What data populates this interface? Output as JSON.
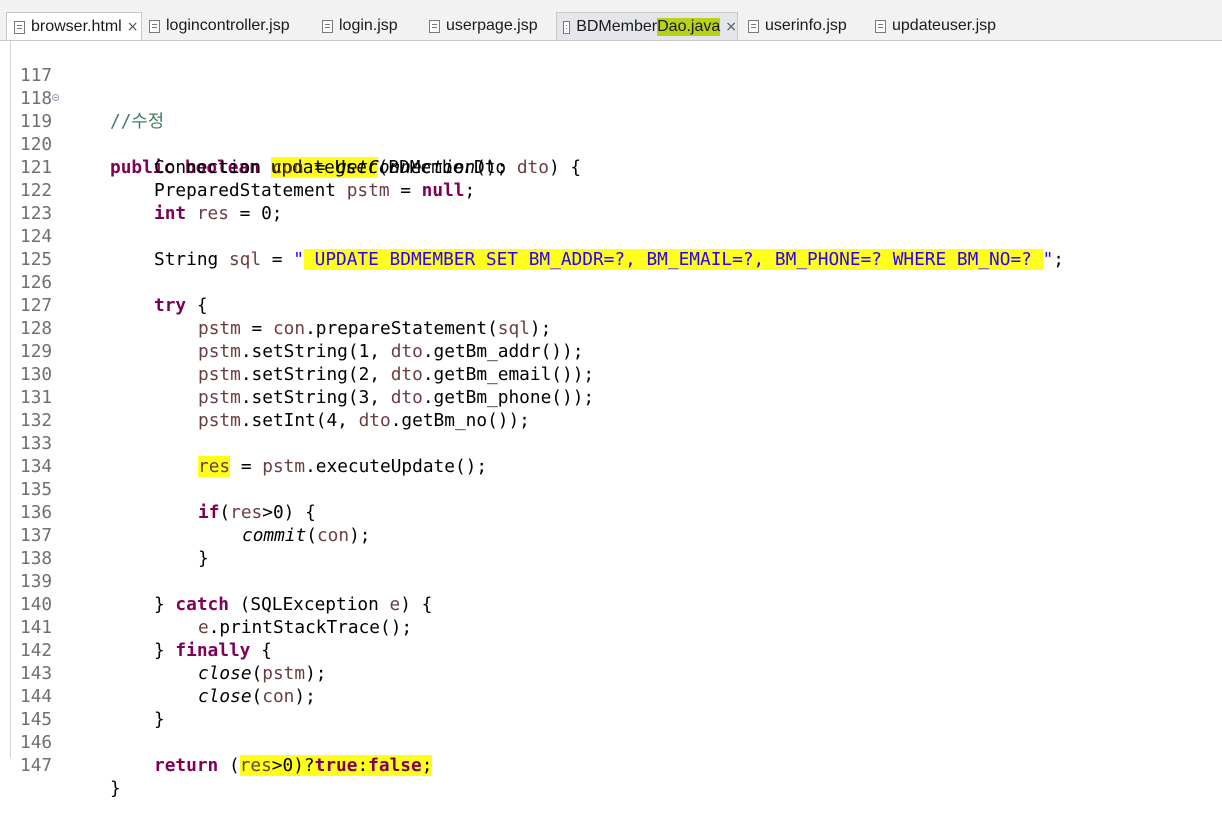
{
  "tabs": [
    {
      "label": "browser.html",
      "icon": "html-file-icon",
      "active": true,
      "closable": true
    },
    {
      "label": "logincontroller.jsp",
      "icon": "jsp-file-icon"
    },
    {
      "label": "login.jsp",
      "icon": "jsp-file-icon"
    },
    {
      "label": "userpage.jsp",
      "icon": "jsp-file-icon"
    },
    {
      "label_prefix": "BDMember",
      "label_highlight": "Dao.java",
      "icon": "java-file-icon",
      "selected": true,
      "closable": true
    },
    {
      "label": "userinfo.jsp",
      "icon": "jsp-file-icon"
    },
    {
      "label": "updateuser.jsp",
      "icon": "jsp-file-icon"
    }
  ],
  "close_glyph": "×",
  "highlight_color": "#ffff1a",
  "line_numbers": [
    "117",
    "118",
    "119",
    "120",
    "121",
    "122",
    "123",
    "124",
    "125",
    "126",
    "127",
    "128",
    "129",
    "130",
    "131",
    "132",
    "133",
    "134",
    "135",
    "136",
    "137",
    "138",
    "139",
    "140",
    "141",
    "142",
    "143",
    "144",
    "145",
    "146",
    "147"
  ],
  "code": {
    "l118": "//수정",
    "l119": [
      "public",
      " ",
      "boolean",
      " ",
      "updateUser",
      "(BDMemberDto ",
      "dto",
      ") {"
    ],
    "l120": [
      "Connection ",
      "con",
      " = ",
      "getConnection",
      "();"
    ],
    "l121": [
      "PreparedStatement ",
      "pstm",
      " = ",
      "null",
      ";"
    ],
    "l122": [
      "int",
      " ",
      "res",
      " = 0;"
    ],
    "l124": [
      "String ",
      "sql",
      " = ",
      "\"",
      " UPDATE BDMEMBER SET BM_ADDR=?, BM_EMAIL=?, BM_PHONE=? WHERE BM_NO=? ",
      "\"",
      ";"
    ],
    "l126": [
      "try",
      " {"
    ],
    "l127": [
      "pstm",
      " = ",
      "con",
      ".prepareStatement(",
      "sql",
      ");"
    ],
    "l128": [
      "pstm",
      ".setString(1, ",
      "dto",
      ".getBm_addr());"
    ],
    "l129": [
      "pstm",
      ".setString(2, ",
      "dto",
      ".getBm_email());"
    ],
    "l130": [
      "pstm",
      ".setString(3, ",
      "dto",
      ".getBm_phone());"
    ],
    "l131": [
      "pstm",
      ".setInt(4, ",
      "dto",
      ".getBm_no());"
    ],
    "l133": [
      "res",
      " = ",
      "pstm",
      ".executeUpdate();"
    ],
    "l135": [
      "if",
      "(",
      "res",
      ">0) {"
    ],
    "l136": [
      "commit",
      "(",
      "con",
      ");"
    ],
    "l137": "}",
    "l139": [
      "} ",
      "catch",
      " (SQLException ",
      "e",
      ") {"
    ],
    "l140": [
      "e",
      ".printStackTrace();"
    ],
    "l141": [
      "} ",
      "finally",
      " {"
    ],
    "l142": [
      "close",
      "(",
      "pstm",
      ");"
    ],
    "l143": [
      "close",
      "(",
      "con",
      ");"
    ],
    "l144": "}",
    "l146": [
      "return",
      " ",
      "(",
      "res",
      ">0)?",
      "true",
      ":",
      "false",
      ";"
    ],
    "l147": "}"
  }
}
